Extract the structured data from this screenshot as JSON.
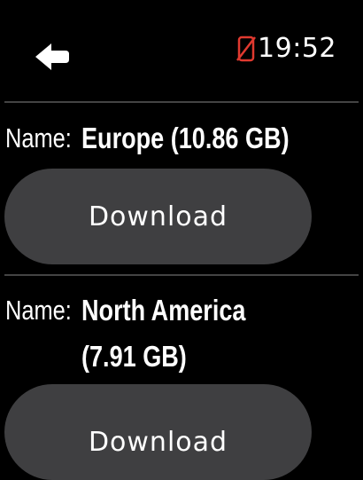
{
  "status_bar": {
    "time": "19:52",
    "back_icon": "left-arrow-icon",
    "phone_icon": "phone-disconnected-icon",
    "phone_icon_color": "#e0392f"
  },
  "regions": [
    {
      "name_label": "Name:",
      "name_value_line1": "Europe (10.86 GB)",
      "name_value_line2": "",
      "button_label": "Download"
    },
    {
      "name_label": "Name:",
      "name_value_line1": "North America",
      "name_value_line2": "(7.91 GB)",
      "button_label": "Download"
    }
  ],
  "colors": {
    "background": "#000000",
    "button": "#3f3f41",
    "divider": "#444444",
    "text": "#ffffff"
  }
}
